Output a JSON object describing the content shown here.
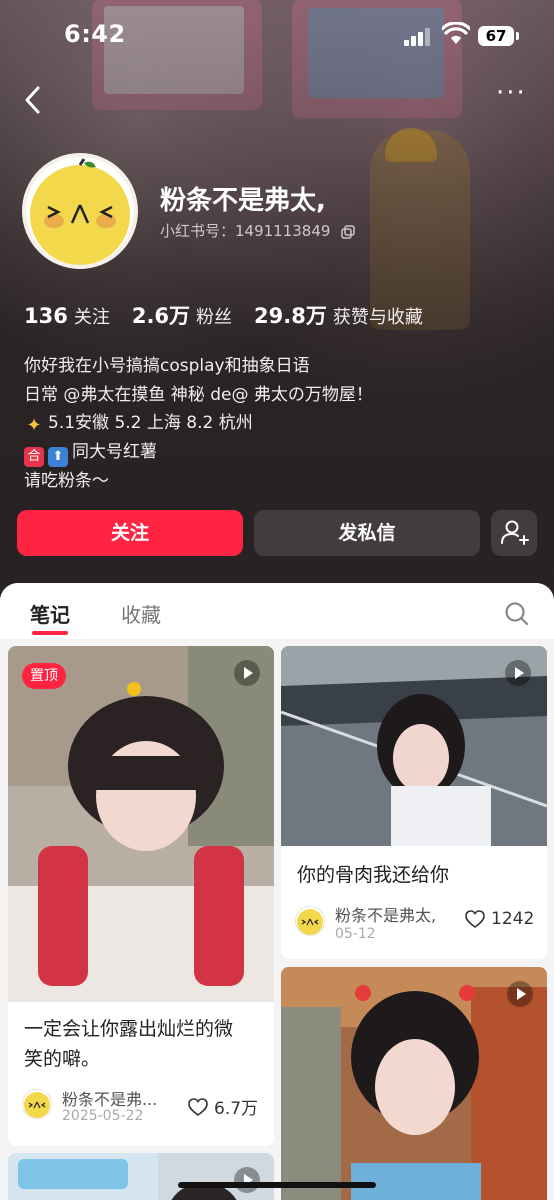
{
  "status_bar": {
    "time": "6:42",
    "battery": "67"
  },
  "profile": {
    "nickname": "粉条不是弗太,",
    "red_id": "小红书号：1491113849",
    "stats": [
      {
        "value": "136",
        "label": "关注"
      },
      {
        "value": "2.6万",
        "label": "粉丝"
      },
      {
        "value": "29.8万",
        "label": "获赞与收藏"
      }
    ],
    "bio": [
      "你好我在小号搞搞cosplay和抽象日语",
      "日常 @弗太在摸鱼 神秘 de@ 弗太の万物屋！",
      "5.1安徽 5.2 上海 8.2 杭州",
      "同大号红薯",
      "请吃粉条～"
    ]
  },
  "actions": {
    "follow": "关注",
    "message": "发私信"
  },
  "tabs": {
    "notes": "笔记",
    "collect": "收藏"
  },
  "notes": [
    {
      "pinned_label": "置顶",
      "title_line1": "一定会让你露出灿烂的微",
      "title_line2": "笑的噼。",
      "author": "粉条不是弗...",
      "date": "2025-05-22",
      "likes": "6.7万"
    },
    {
      "title_line1": "你的骨肉我还给你",
      "author": "粉条不是弗太,",
      "date": "05-12",
      "likes": "1242"
    }
  ],
  "colors": {
    "brand": "#ff2442"
  },
  "icons": [
    "back-icon",
    "more-icon",
    "copy-icon",
    "add-user-icon",
    "search-icon",
    "play-icon",
    "heart-icon"
  ]
}
